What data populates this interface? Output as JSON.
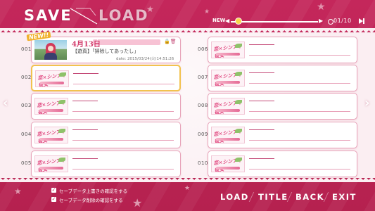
{
  "header": {
    "title_save": "SAVE",
    "title_load": "LOAD",
    "new_label": "NEW",
    "page_indicator": "01/10",
    "slider_position": 0.05
  },
  "new_badge": "NEW!!",
  "slots_left": [
    {
      "number": "001",
      "filled": true,
      "date_title": "4月13日",
      "scene_text": "【遊真】「掃除してあったし」",
      "save_date": "date: 2015/03/24(火)14:51:26"
    },
    {
      "number": "002",
      "filled": false,
      "selected": true,
      "logo": "恋×シンアイ彼女"
    },
    {
      "number": "003",
      "filled": false,
      "logo": "恋×シンアイ彼女"
    },
    {
      "number": "004",
      "filled": false,
      "logo": "恋×シンアイ彼女"
    },
    {
      "number": "005",
      "filled": false,
      "logo": "恋×シンアイ彼女"
    }
  ],
  "slots_right": [
    {
      "number": "006",
      "filled": false,
      "logo": "恋×シンアイ彼女"
    },
    {
      "number": "007",
      "filled": false,
      "logo": "恋×シンアイ彼女"
    },
    {
      "number": "008",
      "filled": false,
      "logo": "恋×シンアイ彼女"
    },
    {
      "number": "009",
      "filled": false,
      "logo": "恋×シンアイ彼女"
    },
    {
      "number": "010",
      "filled": false,
      "logo": "恋×シンアイ彼女"
    }
  ],
  "options": [
    {
      "label": "セーブデータ上書きの確認をする",
      "checked": true
    },
    {
      "label": "セーブデータ削除の確認をする",
      "checked": true
    }
  ],
  "footer_buttons": {
    "load": "LOAD",
    "title": "TITLE",
    "back": "BACK",
    "exit": "EXIT"
  },
  "colors": {
    "accent": "#c4275b",
    "panel": "#fbeef2",
    "selected_border": "#f2c24e"
  }
}
